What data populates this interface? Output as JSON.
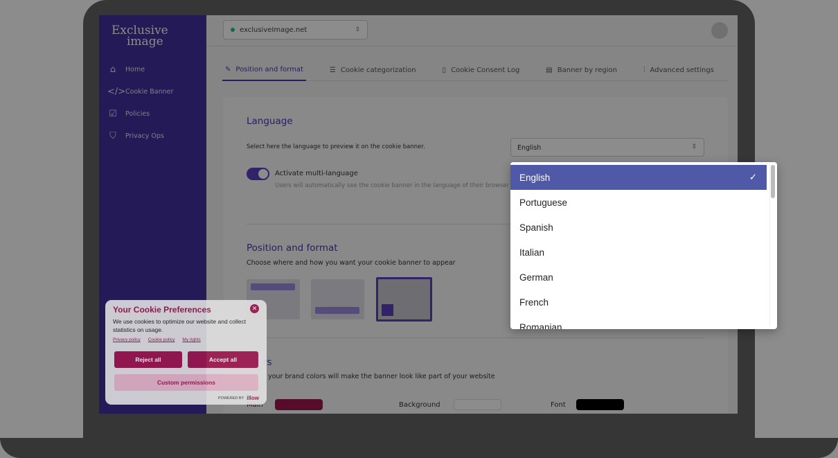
{
  "brand": {
    "logo_line1": "Exclusive",
    "logo_line2": "image"
  },
  "sidebar": {
    "items": [
      {
        "label": "Home",
        "icon": "home-icon"
      },
      {
        "label": "Cookie Banner",
        "icon": "code-icon"
      },
      {
        "label": "Policies",
        "icon": "clipboard-check-icon"
      },
      {
        "label": "Privacy Ops",
        "icon": "shield-check-icon"
      }
    ]
  },
  "header": {
    "site": "exclusiveImage.net"
  },
  "tabs": [
    {
      "label": "Position and format",
      "active": true
    },
    {
      "label": "Cookie categorization"
    },
    {
      "label": "Cookie Consent Log"
    },
    {
      "label": "Banner by region"
    },
    {
      "label": "Advanced settings"
    }
  ],
  "language": {
    "title": "Language",
    "desc": "Select here the language to preview it on the cookie banner.",
    "selected": "English",
    "toggle_label": "Activate multi-language",
    "toggle_on": true,
    "toggle_desc": "Users will automatically see the cookie banner in the language of their browser"
  },
  "position": {
    "title": "Position and format",
    "desc": "Choose where and how you want your cookie banner to appear",
    "selected_index": 2
  },
  "colors": {
    "title": "rs",
    "desc": "your brand colors will make the banner look like part of your website",
    "main_label": "Main",
    "background_label": "Background",
    "font_label": "Font",
    "main": "#a0164f",
    "background": "#ffffff",
    "font": "#000000"
  },
  "popup": {
    "title": "Your Cookie Preferences",
    "message": "We use cookies to optimize our website and collect statistics on usage.",
    "links": [
      "Privacy policy",
      "Cookie policy",
      "My rights"
    ],
    "reject": "Reject all",
    "accept": "Accept all",
    "custom": "Custom permissions",
    "powered": "POWERED BY",
    "powered_brand": "illow"
  },
  "dropdown": {
    "options": [
      "English",
      "Portuguese",
      "Spanish",
      "Italian",
      "German",
      "French",
      "Romanian"
    ],
    "selected": "English"
  },
  "colors_theme": {
    "accent": "#4a35b5",
    "selected_option": "#5058a8"
  }
}
